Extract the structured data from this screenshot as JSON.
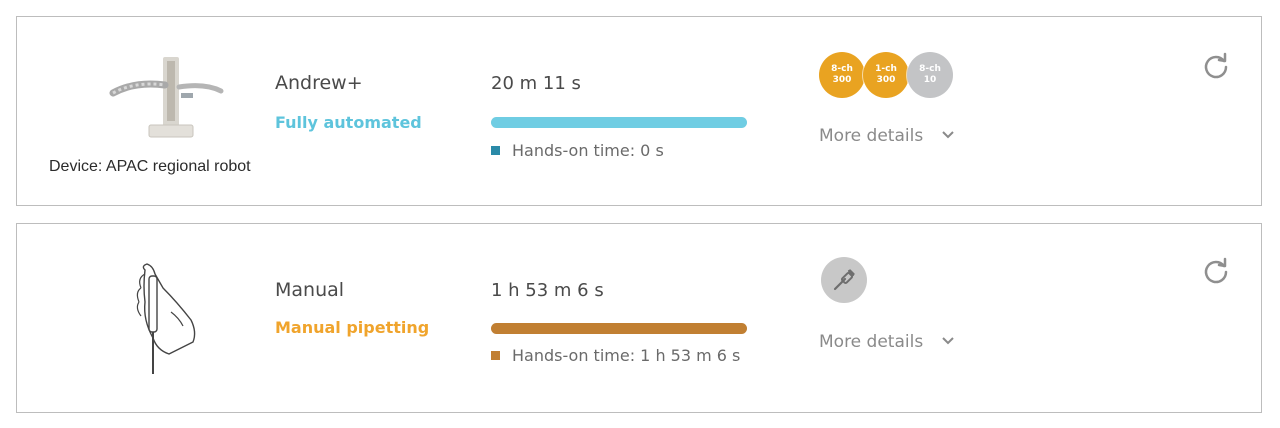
{
  "cards": [
    {
      "device_name": "Andrew+",
      "mode_label": "Fully automated",
      "mode_color": "#5ec4dc",
      "time": "20 m 11 s",
      "hands_on_label": "Hands-on time: 0 s",
      "hands_on_color": "#2a8aa8",
      "bar_color": "#6fcde3",
      "bar_fraction": 1.0,
      "device_caption": "Device: APAC regional robot",
      "tools": [
        {
          "line1": "8-ch",
          "line2": "300",
          "color": "#e9a321"
        },
        {
          "line1": "1-ch",
          "line2": "300",
          "color": "#e9a321"
        },
        {
          "line1": "8-ch",
          "line2": "10",
          "color": "#c3c4c6"
        }
      ],
      "more_details": "More details",
      "icons": {
        "refresh": "refresh-icon",
        "chevron": "chevron-down-icon"
      }
    },
    {
      "device_name": "Manual",
      "mode_label": "Manual pipetting",
      "mode_color": "#f0a42c",
      "time": "1 h 53 m 6 s",
      "hands_on_label": "Hands-on time: 1 h 53 m 6 s",
      "hands_on_color": "#c17f32",
      "bar_color": "#c17f32",
      "bar_fraction": 1.0,
      "tool_icon": "pipette-icon",
      "more_details": "More details",
      "icons": {
        "refresh": "refresh-icon",
        "chevron": "chevron-down-icon"
      }
    }
  ]
}
